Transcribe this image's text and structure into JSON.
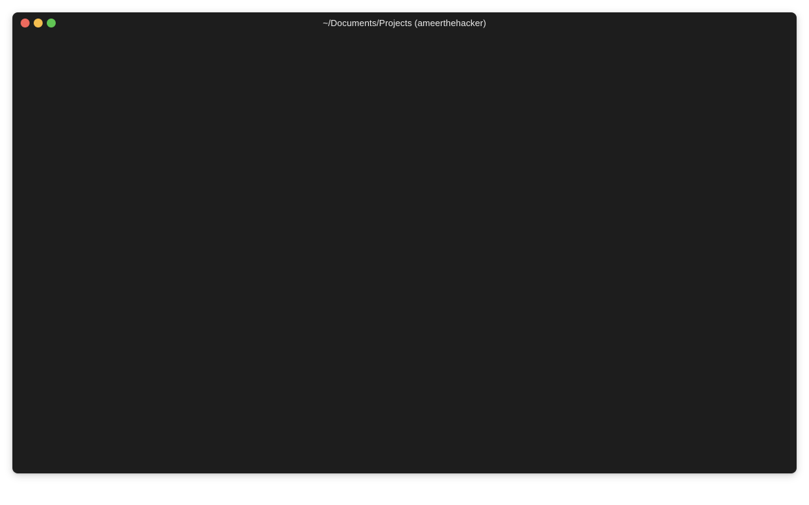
{
  "window": {
    "title": "~/Documents/Projects (ameerthehacker)"
  },
  "trafficLights": {
    "close": "red",
    "minimize": "yellow",
    "maximize": "green"
  }
}
